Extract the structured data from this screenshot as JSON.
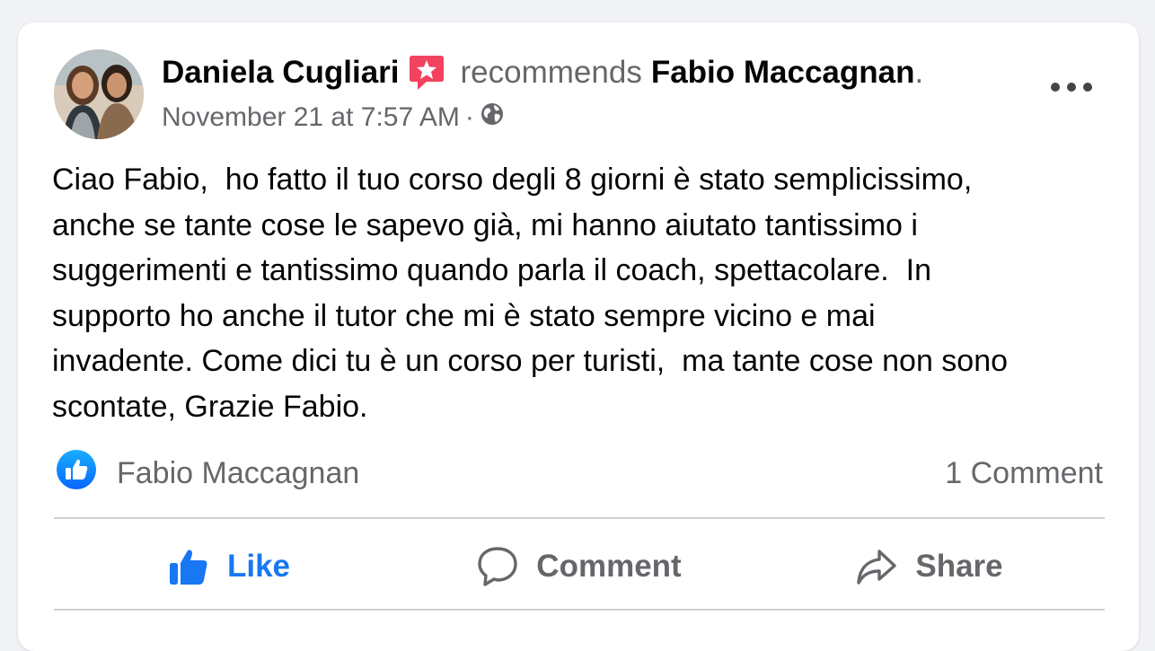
{
  "post": {
    "author": "Daniela Cugliari",
    "recommends_text": "recommends",
    "page_name": "Fabio Maccagnan",
    "period": ".",
    "timestamp": "November 21 at 7:57 AM",
    "separator": "·",
    "audience_icon": "globe-icon",
    "body_lines": [
      "Ciao Fabio,  ho fatto il tuo corso degli 8 giorni è stato semplicissimo,",
      "anche se tante cose le sapevo già, mi hanno aiutato tantissimo i",
      "suggerimenti e tantissimo quando parla il coach, spettacolare.  In",
      "supporto ho anche il tutor che mi è stato sempre vicino e mai",
      "invadente. Come dici tu è un corso per turisti,  ma tante cose non sono",
      "scontate, Grazie Fabio."
    ]
  },
  "reactions": {
    "liked_by": "Fabio Maccagnan",
    "comments_count": "1 Comment"
  },
  "actions": {
    "like": "Like",
    "comment": "Comment",
    "share": "Share"
  },
  "colors": {
    "accent": "#1877f2",
    "recommend_badge": "#f3425f",
    "secondary_text": "#65676b",
    "primary_text": "#050505"
  }
}
